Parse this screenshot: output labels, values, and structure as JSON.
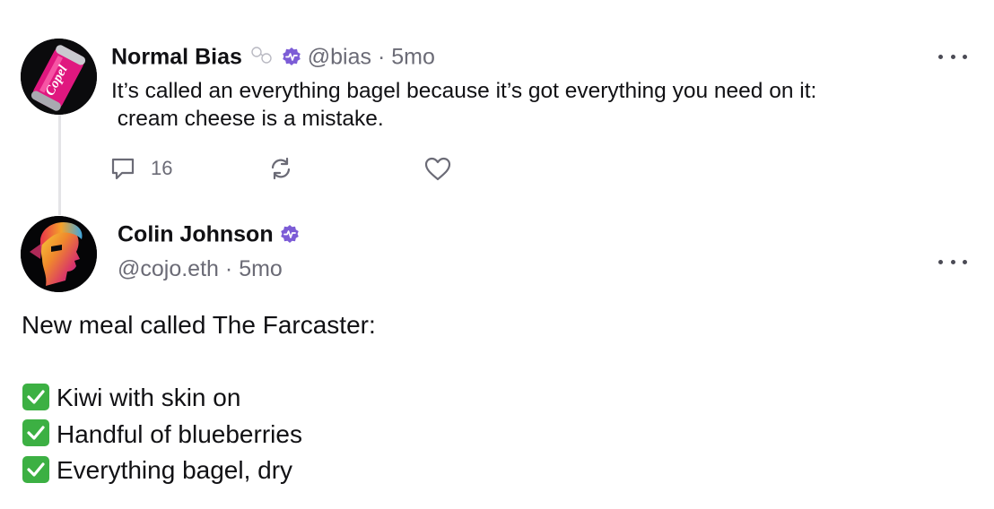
{
  "posts": [
    {
      "author": {
        "name": "Normal Bias",
        "handle": "@bias",
        "avatar_label": "Copel"
      },
      "separator": "·",
      "time": "5mo",
      "text_line1": "It’s called an everything bagel because it’s got everything you need on it:",
      "text_line2": " cream cheese is a mistake.",
      "replies": "16",
      "icons": [
        "glasses-icon",
        "verified-badge-icon",
        "more-icon",
        "reply-icon",
        "recast-icon",
        "heart-icon"
      ]
    },
    {
      "author": {
        "name": "Colin Johnson",
        "handle": "@cojo.eth"
      },
      "separator": "·",
      "time": "5mo",
      "intro": "New meal called The Farcaster:",
      "items": [
        "Kiwi with skin on",
        "Handful of blueberries",
        "Everything bagel, dry"
      ],
      "icons": [
        "verified-badge-icon",
        "more-icon",
        "check-mark-icon"
      ]
    }
  ],
  "colors": {
    "verified": "#7c5cd6",
    "check": "#3cb043",
    "muted_text": "#6b6b76",
    "thread_line": "#e4e4e7"
  }
}
